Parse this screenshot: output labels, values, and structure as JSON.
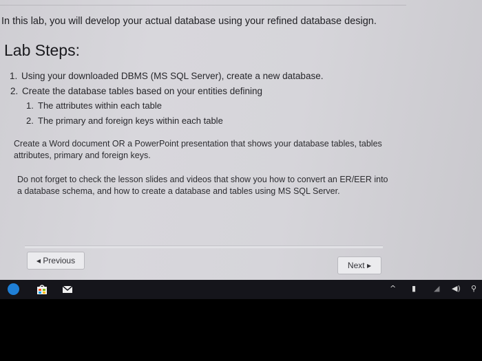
{
  "content": {
    "intro": "In this lab, you will develop your actual database using your refined database design.",
    "heading": "Lab Steps:",
    "steps": [
      {
        "num": "1.",
        "text": "Using your downloaded DBMS (MS SQL Server), create a new database."
      },
      {
        "num": "2.",
        "text": "Create the database tables based on your entities defining"
      }
    ],
    "substeps": [
      {
        "num": "1.",
        "text": "The attributes within each table"
      },
      {
        "num": "2.",
        "text": "The primary and foreign keys within each table"
      }
    ],
    "paragraph1": "Create a Word document OR a PowerPoint presentation that shows your database tables, tables attributes, primary and foreign keys.",
    "paragraph2": "Do not forget to check the lesson slides and videos that show you how to convert an ER/EER into a database schema, and how to create a database and tables using MS SQL Server."
  },
  "navigation": {
    "previous_label": "Previous",
    "next_label": "Next"
  },
  "taskbar": {
    "icons": [
      "edge-icon",
      "store-icon",
      "mail-icon"
    ],
    "tray": [
      "chevron-up-icon",
      "battery-icon",
      "wifi-icon",
      "volume-icon",
      "network-icon"
    ]
  },
  "colors": {
    "page_background": "#d5d4d9",
    "taskbar": "#15151b",
    "edge_blue": "#1f7fd6"
  }
}
